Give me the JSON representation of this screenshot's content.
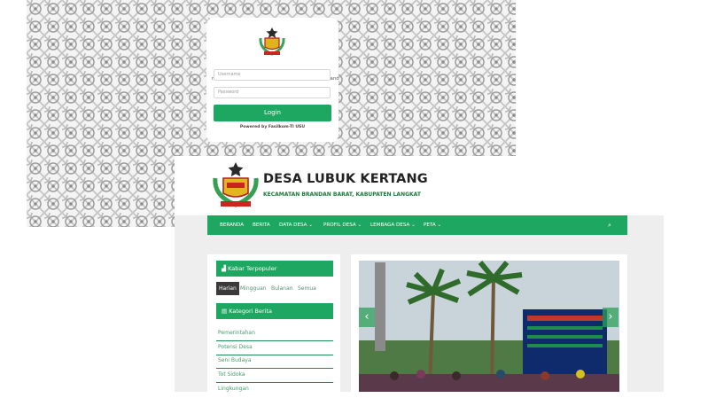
{
  "login": {
    "welcome_text": "nat datang di Desa Lubuk Kertang, Kecamatan Brandan",
    "username_placeholder": "Username",
    "password_placeholder": "Password",
    "login_label": "Login",
    "powered_by": "Powered by Fasilkom-TI USU"
  },
  "site": {
    "title": "DESA LUBUK KERTANG",
    "subtitle": "KECAMATAN BRANDAN BARAT, KABUPATEN LANGKAT",
    "nav": [
      {
        "label": "BERANDA"
      },
      {
        "label": "BERITA"
      },
      {
        "label": "DATA DESA ⌄"
      },
      {
        "label": "PROFIL DESA ⌄"
      },
      {
        "label": "LEMBAGA DESA ⌄"
      },
      {
        "label": "PETA ⌄"
      }
    ],
    "search_icon": "search-icon"
  },
  "sidebar": {
    "popular_title": "▟ Kabar Terpopuler",
    "popular_tabs": [
      "Harian",
      "Mingguan",
      "Bulanan",
      "Semua"
    ],
    "category_title": "▤ Kategori Berita",
    "categories": [
      "Pemerintahan",
      "Potensi Desa",
      "Seni Budaya",
      "Tot Sidoka",
      "Lingkungan"
    ]
  },
  "slider": {
    "prev": "‹",
    "next": "›"
  },
  "colors": {
    "accent": "#1ea760",
    "dark_green": "#1a7a3c"
  }
}
